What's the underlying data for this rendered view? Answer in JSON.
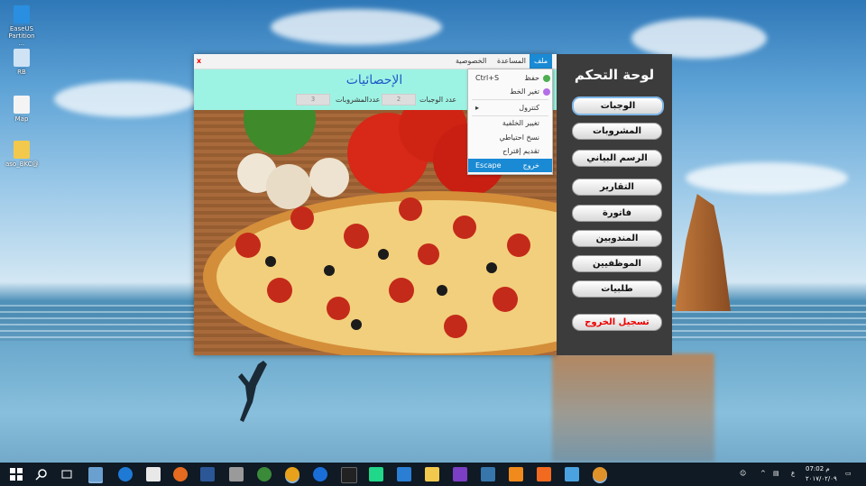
{
  "desktop": {
    "icons": [
      {
        "label": "EaseUS Partition ...",
        "icon": "easeus-icon"
      },
      {
        "label": "RB",
        "icon": "recycle-bin-icon"
      },
      {
        "label": "Map",
        "icon": "file-icon"
      },
      {
        "label": "aso_BKC@",
        "icon": "zip-folder-icon"
      }
    ]
  },
  "window": {
    "close_label": "x",
    "menu": [
      "ملف",
      "المساعدة",
      "الخصوصية"
    ],
    "title": "الإحصائيات",
    "meals_label": "عدد الوجبات",
    "meals_value": "2",
    "drinks_label": "عددالمشروبات",
    "drinks_value": "3"
  },
  "dropdown": {
    "items": [
      {
        "label": "حفظ",
        "shortcut": "Ctrl+S",
        "icon": "save-icon"
      },
      {
        "label": "تغير الخط",
        "shortcut": "",
        "icon": "font-icon"
      },
      {
        "label": "كنترول",
        "shortcut": "▸",
        "icon": ""
      },
      {
        "label": "تغيير الخلفية",
        "shortcut": "",
        "icon": ""
      },
      {
        "label": "نسخ احتياطي",
        "shortcut": "",
        "icon": ""
      },
      {
        "label": "تقديم إقتراح",
        "shortcut": "",
        "icon": ""
      },
      {
        "label": "خروج",
        "shortcut": "Escape",
        "icon": ""
      }
    ]
  },
  "panel": {
    "title": "لوحة التحكم",
    "buttons": [
      "الوجبات",
      "المشروبات",
      "الرسم البياني",
      "التقارير",
      "فاتورة",
      "المندوبين",
      "الموظفيين",
      "طلبيات"
    ],
    "logout": "تسجيل الخروج"
  },
  "taskbar": {
    "time": "07:02 م",
    "date": "٢٠١٧/٠٢/٠٩",
    "lang": "ع",
    "colors": {
      "bar": "#0f1a24",
      "accent": "#1a8ad4"
    }
  }
}
